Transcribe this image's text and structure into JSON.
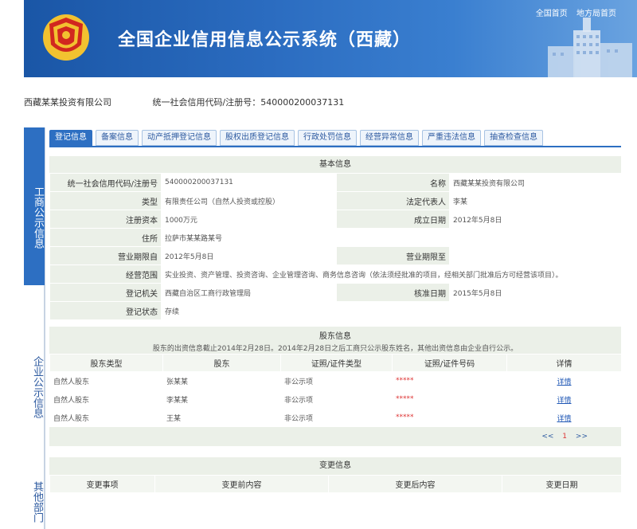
{
  "header": {
    "title": "全国企业信用信息公示系统（西藏）",
    "links": [
      "全国首页",
      "地方局首页"
    ]
  },
  "company": {
    "name": "西藏某某投资有限公司",
    "code_label": "统一社会信用代码/注册号：",
    "code_value": "540000200037131"
  },
  "side_tabs": [
    "工商公示信息",
    "企业公示信息",
    "其他部门"
  ],
  "tabs": [
    "登记信息",
    "备案信息",
    "动产抵押登记信息",
    "股权出质登记信息",
    "行政处罚信息",
    "经营异常信息",
    "严重违法信息",
    "抽查检查信息"
  ],
  "basic": {
    "section_title": "基本信息",
    "fields": {
      "reg_no_label": "统一社会信用代码/注册号",
      "reg_no": "540000200037131",
      "name_label": "名称",
      "name": "西藏某某投资有限公司",
      "type_label": "类型",
      "type": "有限责任公司（自然人投资或控股）",
      "rep_label": "法定代表人",
      "rep": "李某",
      "capital_label": "注册资本",
      "capital": "1000万元",
      "found_label": "成立日期",
      "found": "2012年5月8日",
      "addr_label": "住所",
      "addr": "拉萨市某某路某号",
      "from_label": "营业期限自",
      "from": "2012年5月8日",
      "to_label": "营业期限至",
      "to": "",
      "scope_label": "经营范围",
      "scope": "实业投资、资产管理、投资咨询、企业管理咨询、商务信息咨询（依法须经批准的项目，经相关部门批准后方可经营该项目）。",
      "auth_label": "登记机关",
      "auth": "西藏自治区工商行政管理局",
      "approve_label": "核准日期",
      "approve": "2015年5月8日",
      "status_label": "登记状态",
      "status": "存续"
    }
  },
  "partners": {
    "title": "股东信息",
    "note": "股东的出资信息截止2014年2月28日。2014年2月28日之后工商只公示股东姓名，其他出资信息由企业自行公示。",
    "headers": [
      "股东类型",
      "股东",
      "证照/证件类型",
      "证照/证件号码",
      "详情"
    ],
    "rows": [
      {
        "type": "自然人股东",
        "name": "张某某",
        "id_type": "非公示项",
        "id_no": "*****",
        "detail": "详情"
      },
      {
        "type": "自然人股东",
        "name": "李某某",
        "id_type": "非公示项",
        "id_no": "*****",
        "detail": "详情"
      },
      {
        "type": "自然人股东",
        "name": "王某",
        "id_type": "非公示项",
        "id_no": "*****",
        "detail": "详情"
      }
    ],
    "pager": [
      "<<",
      "1",
      ">>"
    ]
  },
  "changes": {
    "title": "变更信息",
    "headers": [
      "变更事项",
      "变更前内容",
      "变更后内容",
      "变更日期"
    ]
  },
  "colors": {
    "banner": "#2b6cc0",
    "accent": "#2d6fc2",
    "label_bg": "#ebf0e8"
  }
}
